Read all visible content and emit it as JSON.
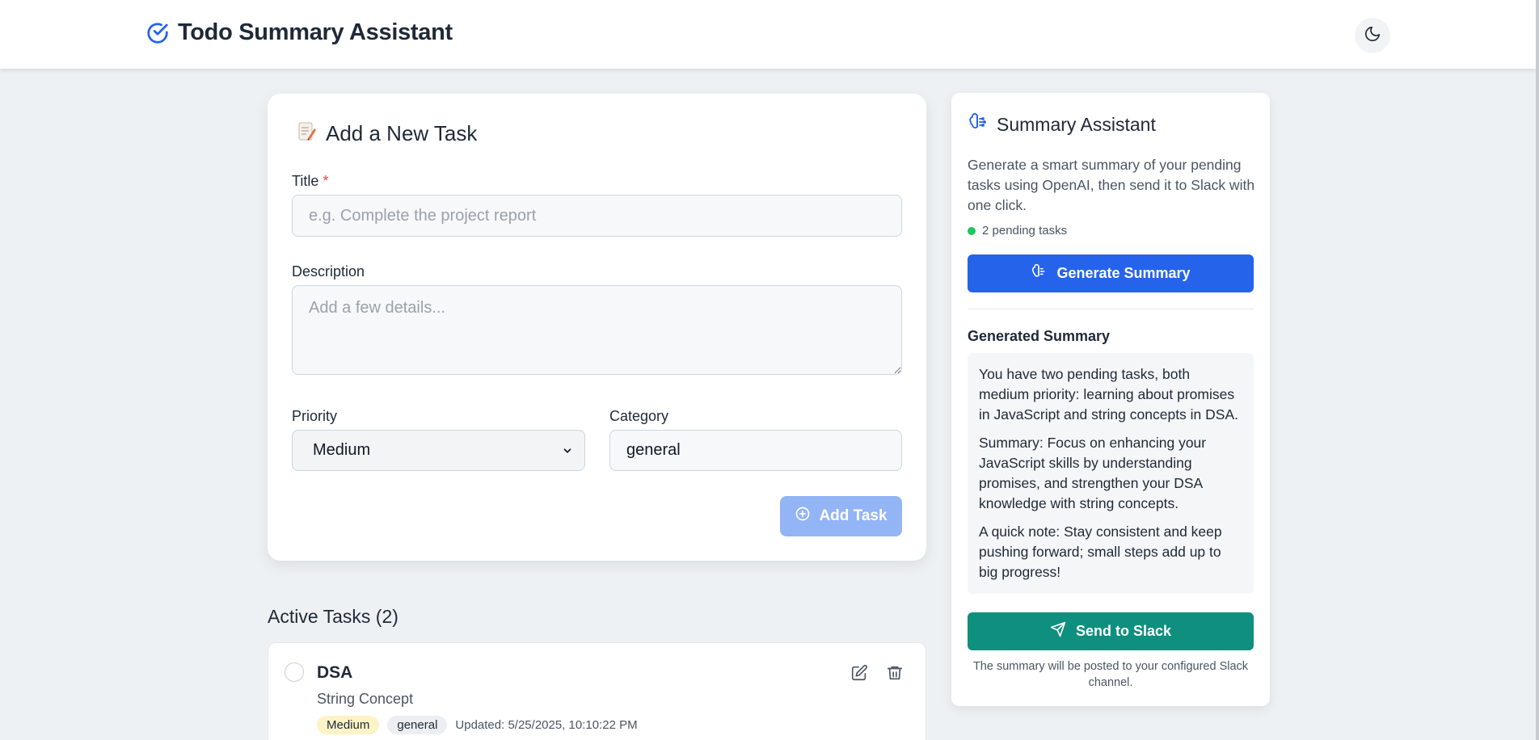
{
  "header": {
    "title": "Todo Summary Assistant",
    "logo_icon": "check-circle-icon",
    "theme_toggle_icon": "moon-icon"
  },
  "add_task": {
    "title": "Add a New Task",
    "title_icon": "memo-icon",
    "title_label": "Title",
    "required_mark": "*",
    "title_placeholder": "e.g. Complete the project report",
    "description_label": "Description",
    "description_placeholder": "Add a few details...",
    "priority_label": "Priority",
    "priority_value": "Medium",
    "category_label": "Category",
    "category_value": "general",
    "add_button": "Add Task"
  },
  "tasks": {
    "heading": "Active Tasks (2)",
    "items": [
      {
        "title": "DSA",
        "description": "String Concept",
        "priority": "Medium",
        "category": "general",
        "updated": "Updated: 5/25/2025, 10:10:22 PM"
      }
    ]
  },
  "summary": {
    "title": "Summary Assistant",
    "description": "Generate a smart summary of your pending tasks using OpenAI, then send it to Slack with one click.",
    "pending": "2 pending tasks",
    "generate_button": "Generate Summary",
    "generated_heading": "Generated Summary",
    "paragraphs": [
      "You have two pending tasks, both medium priority: learning about promises in JavaScript and string concepts in DSA.",
      "Summary: Focus on enhancing your JavaScript skills by understanding promises, and strengthen your DSA knowledge with string concepts.",
      "A quick note: Stay consistent and keep pushing forward; small steps add up to big progress!"
    ],
    "slack_button": "Send to Slack",
    "slack_note": "The summary will be posted to your configured Slack channel."
  },
  "colors": {
    "primary": "#2563eb",
    "slack": "#0f8f7e",
    "add_button_disabled": "#93b4f5",
    "pending_dot": "#22c55e"
  }
}
